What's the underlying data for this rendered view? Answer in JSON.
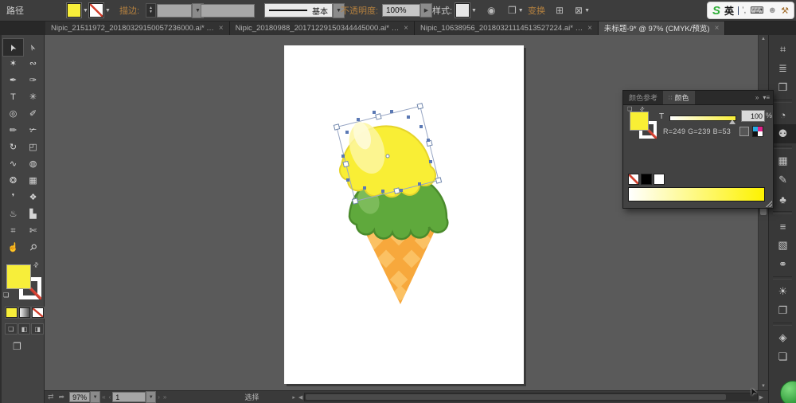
{
  "topbar": {
    "object_label": "路径",
    "fill_color": "#f7ee3a",
    "stroke_color": "none",
    "stroke_label": "描边:",
    "stroke_style": "基本",
    "opacity_label": "不透明度:",
    "opacity_value": "100%",
    "style_label": "样式:",
    "transform_label": "变换"
  },
  "ime": {
    "logo": "S",
    "lang": "英"
  },
  "tabs": [
    {
      "title": "Nipic_21511972_20180329150057236000.ai* …",
      "close": "×",
      "active": false
    },
    {
      "title": "Nipic_20180988_20171229150344445000.ai* …",
      "close": "×",
      "active": false
    },
    {
      "title": "Nipic_10638956_20180321114513527224.ai* …",
      "close": "×",
      "active": false
    },
    {
      "title": "未标题-9* @ 97% (CMYK/预览)",
      "close": "×",
      "active": true
    }
  ],
  "tools": [
    {
      "name": "selection-tool",
      "glyph": "➤",
      "rot": -115,
      "active": true
    },
    {
      "name": "direct-selection-tool",
      "glyph": "➢",
      "rot": -115
    },
    {
      "name": "magic-wand-tool",
      "glyph": "✶"
    },
    {
      "name": "lasso-tool",
      "glyph": "∾"
    },
    {
      "name": "pen-tool",
      "glyph": "✒"
    },
    {
      "name": "curvature-tool",
      "glyph": "✑"
    },
    {
      "name": "type-tool",
      "glyph": "T"
    },
    {
      "name": "line-segment-tool",
      "glyph": "✳"
    },
    {
      "name": "shape-tool",
      "glyph": "◎"
    },
    {
      "name": "paintbrush-tool",
      "glyph": "✐"
    },
    {
      "name": "pencil-tool",
      "glyph": "✏"
    },
    {
      "name": "knife-tool",
      "glyph": "✃"
    },
    {
      "name": "rotate-tool",
      "glyph": "↻"
    },
    {
      "name": "free-transform-tool",
      "glyph": "◰"
    },
    {
      "name": "width-tool",
      "glyph": "∿"
    },
    {
      "name": "shape-builder-tool",
      "glyph": "◍"
    },
    {
      "name": "mesh-tool",
      "glyph": "❂"
    },
    {
      "name": "perspective-grid-tool",
      "glyph": "▦"
    },
    {
      "name": "eyedropper-tool",
      "glyph": "❜"
    },
    {
      "name": "blend-tool",
      "glyph": "❖"
    },
    {
      "name": "symbol-sprayer-tool",
      "glyph": "♨"
    },
    {
      "name": "graph-tool",
      "glyph": "▙"
    },
    {
      "name": "artboard-tool",
      "glyph": "⌗"
    },
    {
      "name": "slice-tool",
      "glyph": "✄"
    },
    {
      "name": "hand-tool",
      "glyph": "☝"
    },
    {
      "name": "zoom-tool",
      "glyph": "⚲",
      "rot": 45
    }
  ],
  "dock": [
    {
      "name": "transform-panel-icon",
      "glyph": "⌗"
    },
    {
      "name": "align-panel-icon",
      "glyph": "≣"
    },
    {
      "name": "pathfinder-panel-icon",
      "glyph": "❒"
    },
    {
      "name": "color-guide-panel-icon",
      "glyph": "◔",
      "sep_before": true
    },
    {
      "name": "color-panel-icon",
      "glyph": "⚉",
      "active": true
    },
    {
      "name": "swatches-panel-icon",
      "glyph": "▦",
      "sep_before": true
    },
    {
      "name": "brushes-panel-icon",
      "glyph": "✎"
    },
    {
      "name": "symbols-panel-icon",
      "glyph": "♣"
    },
    {
      "name": "stroke-panel-icon",
      "glyph": "≡",
      "sep_before": true
    },
    {
      "name": "gradient-panel-icon",
      "glyph": "▧"
    },
    {
      "name": "transparency-panel-icon",
      "glyph": "⚭"
    },
    {
      "name": "appearance-panel-icon",
      "glyph": "☀",
      "sep_before": true
    },
    {
      "name": "graphic-styles-panel-icon",
      "glyph": "❐"
    },
    {
      "name": "layers-panel-icon",
      "glyph": "◈",
      "sep_before": true
    },
    {
      "name": "artboards-panel-icon",
      "glyph": "❏"
    }
  ],
  "color_panel": {
    "tab_color_guide": "颜色参考",
    "tab_color": "颜色",
    "tint_label": "T",
    "tint_value": "100",
    "percent_label": "%",
    "rgb_readout": "R=249 G=239 B=53",
    "fill_hex": "#f9ef35"
  },
  "statusbar": {
    "zoom": "97%",
    "artboard": "1",
    "status": "选择"
  },
  "artwork": {
    "scoop_top_color": "#f9ee35",
    "scoop_bottom_color": "#5fa93c",
    "cone_color": "#f7a83c"
  }
}
